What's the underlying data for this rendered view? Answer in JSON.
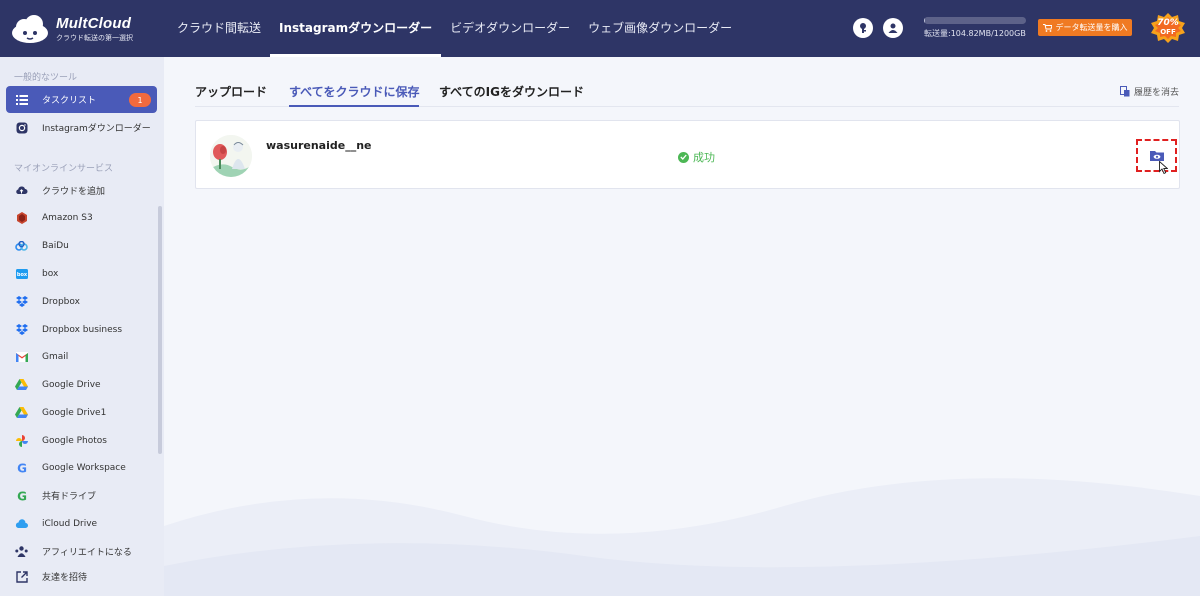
{
  "brand": {
    "title": "MultCloud",
    "subtitle": "クラウド転送の第一選択"
  },
  "nav": [
    {
      "label": "クラウド間転送",
      "active": false
    },
    {
      "label": "Instagramダウンローダー",
      "active": true
    },
    {
      "label": "ビデオダウンローダー",
      "active": false
    },
    {
      "label": "ウェブ画像ダウンローダー",
      "active": false
    }
  ],
  "usage": {
    "text": "転送量:104.82MB/1200GB",
    "fraction": 0.0001
  },
  "buy_button": {
    "label": "データ転送量を購入"
  },
  "promo": {
    "percent": "70%",
    "off": "OFF"
  },
  "sidebar": {
    "section1": "一般的なツール",
    "section2": "マイオンラインサービス",
    "tools": [
      {
        "label": "タスクリスト",
        "icon": "list-icon",
        "badge": "1",
        "active": true
      },
      {
        "label": "Instagramダウンローダー",
        "icon": "instagram-icon"
      }
    ],
    "services": [
      {
        "label": "クラウドを追加",
        "icon": "cloud-upload-icon"
      },
      {
        "label": "Amazon S3",
        "icon": "amazon-s3-icon"
      },
      {
        "label": "BaiDu",
        "icon": "baidu-icon"
      },
      {
        "label": "box",
        "icon": "box-icon"
      },
      {
        "label": "Dropbox",
        "icon": "dropbox-icon"
      },
      {
        "label": "Dropbox business",
        "icon": "dropbox-business-icon"
      },
      {
        "label": "Gmail",
        "icon": "gmail-icon"
      },
      {
        "label": "Google Drive",
        "icon": "google-drive-icon"
      },
      {
        "label": "Google Drive1",
        "icon": "google-drive-icon"
      },
      {
        "label": "Google Photos",
        "icon": "google-photos-icon"
      },
      {
        "label": "Google Workspace",
        "icon": "google-workspace-icon"
      },
      {
        "label": "共有ドライブ",
        "icon": "google-shared-drive-icon"
      },
      {
        "label": "iCloud Drive",
        "icon": "icloud-icon"
      }
    ],
    "footer": [
      {
        "label": "アフィリエイトになる",
        "icon": "affiliate-icon"
      },
      {
        "label": "友達を招待",
        "icon": "invite-icon"
      }
    ]
  },
  "tabs": [
    {
      "label": "アップロード",
      "active": false
    },
    {
      "label": "すべてをクラウドに保存",
      "active": true
    },
    {
      "label": "すべてのIGをダウンロード",
      "active": false
    }
  ],
  "clear_history": "履歴を消去",
  "task": {
    "username": "wasurenaide__ne",
    "status": "成功"
  },
  "colors": {
    "topbar": "#2e3566",
    "accent": "#4a5ab8",
    "success": "#4cb755",
    "buy": "#f07a22"
  }
}
